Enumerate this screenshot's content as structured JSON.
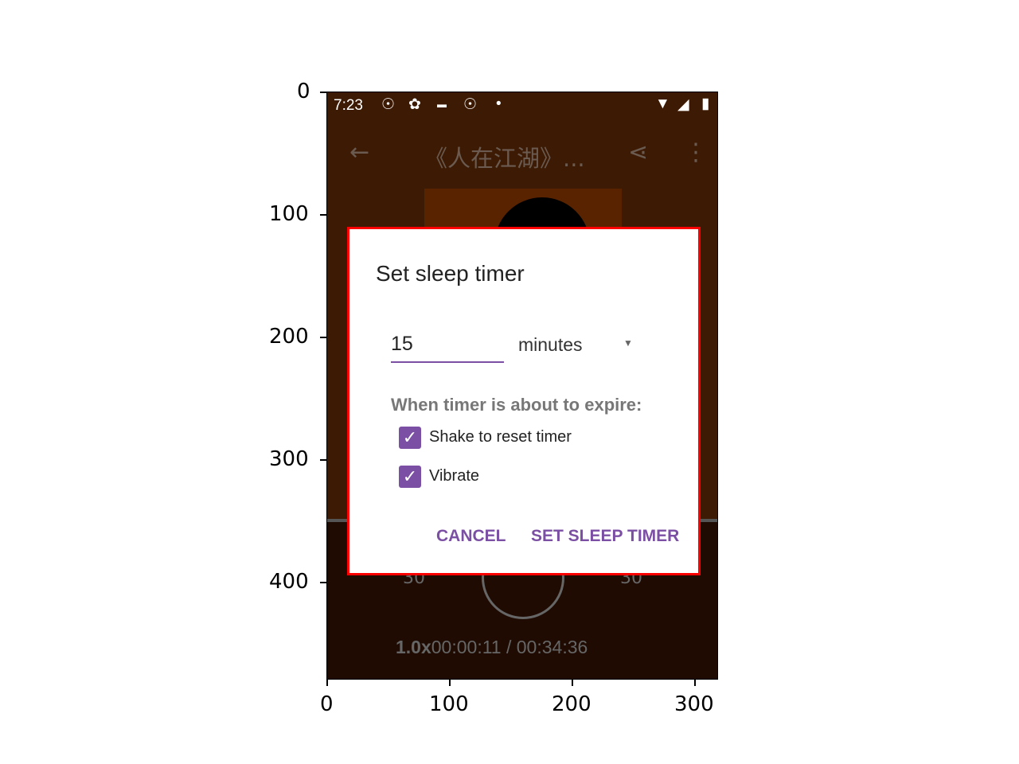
{
  "axes": {
    "x_ticks": [
      "0",
      "100",
      "200",
      "300"
    ],
    "y_ticks": [
      "0",
      "100",
      "200",
      "300",
      "400"
    ]
  },
  "status_bar": {
    "time": "7:23",
    "icons": [
      "podcast-icon",
      "settings-icon",
      "keyboard-icon",
      "podcast-icon",
      "dot-icon",
      "wifi-icon",
      "signal-icon",
      "battery-icon"
    ]
  },
  "app_bar": {
    "title": "《人在江湖》...",
    "icons": [
      "back-arrow-icon",
      "share-icon",
      "more-vert-icon"
    ]
  },
  "player": {
    "speed": "1.0x",
    "position": "00:00:11 / 00:34:36",
    "skip_back": "30",
    "skip_forward": "30"
  },
  "dialog": {
    "title": "Set sleep timer",
    "time_value": "15",
    "unit": "minutes",
    "expire_label": "When timer is about to expire:",
    "options": [
      {
        "label": "Shake to reset timer",
        "checked": true
      },
      {
        "label": "Vibrate",
        "checked": true
      }
    ],
    "cancel": "CANCEL",
    "confirm": "SET SLEEP TIMER"
  },
  "colors": {
    "accent": "#7b4fa3",
    "highlight_border": "#ff0000",
    "background_top": "#3d1a03",
    "background_bottom": "#1f0b02"
  }
}
